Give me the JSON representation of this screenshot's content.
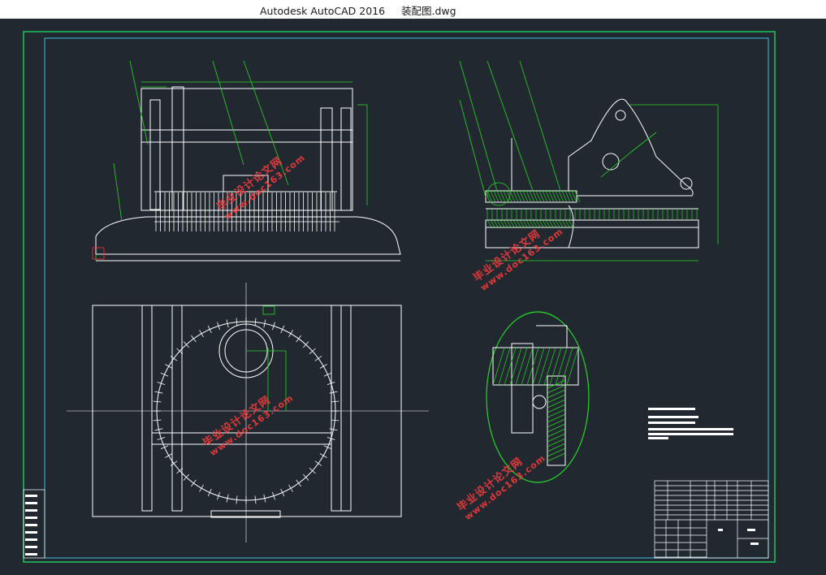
{
  "window": {
    "app_name": "Autodesk AutoCAD 2016",
    "file_name": "装配图.dwg"
  },
  "colors": {
    "background": "#212830",
    "outer_frame": "#22c55e",
    "inner_frame": "#3bc5d6",
    "geometry": "#ffffff",
    "dimension": "#27d627",
    "watermark": "#ff3c3c"
  },
  "watermarks": [
    {
      "text": "毕业设计论文网",
      "site": "www.doc163.com"
    },
    {
      "text": "毕业设计论文网",
      "site": "www.doc163.com"
    },
    {
      "text": "毕业设计论文网",
      "site": "www.doc163.com"
    },
    {
      "text": "毕业设计论文网",
      "site": "www.doc163.com"
    }
  ]
}
